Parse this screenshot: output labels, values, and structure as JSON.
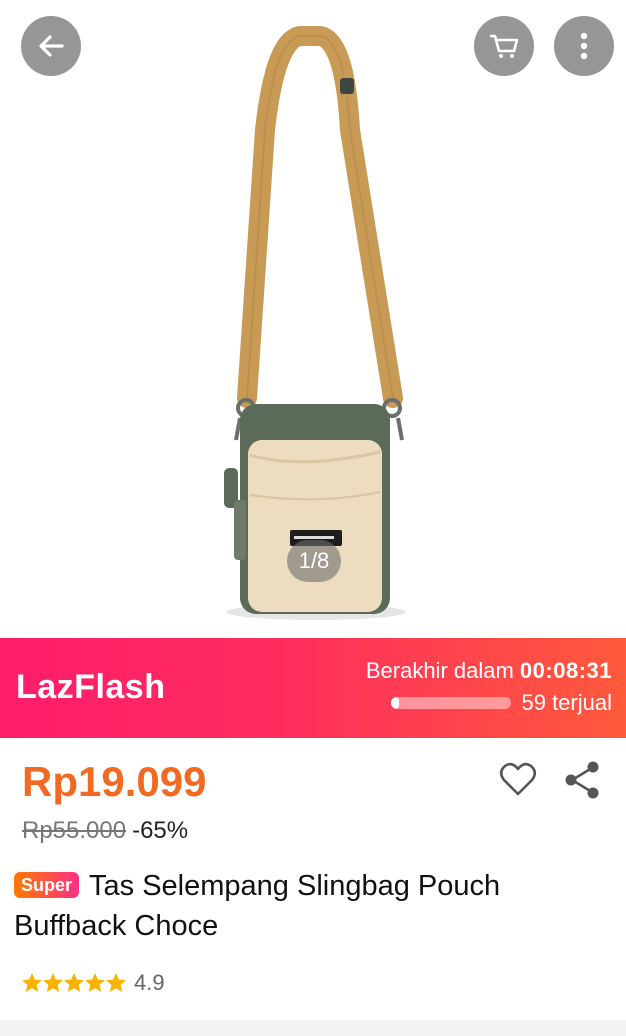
{
  "hero": {
    "image_counter": "1/8",
    "back_icon": "arrow-left-icon",
    "cart_icon": "cart-icon",
    "more_icon": "more-vertical-icon"
  },
  "flash": {
    "logo_text": "LazFlash",
    "ends_in_label": "Berakhir dalam",
    "countdown": "00:08:31",
    "sold_count": "59 terjual",
    "sold_progress": 0.06
  },
  "product": {
    "price": "Rp19.099",
    "original_price": "Rp55.000",
    "discount": "-65%",
    "badge": "Super",
    "title": "Tas Selempang Slingbag Pouch Buffback Choce",
    "rating": "4.9",
    "rating_stars": 4.9
  },
  "colors": {
    "price": "#f26a21",
    "flash_start": "#ff1c6b",
    "flash_end": "#ff5a3c",
    "star": "#f6b300"
  }
}
